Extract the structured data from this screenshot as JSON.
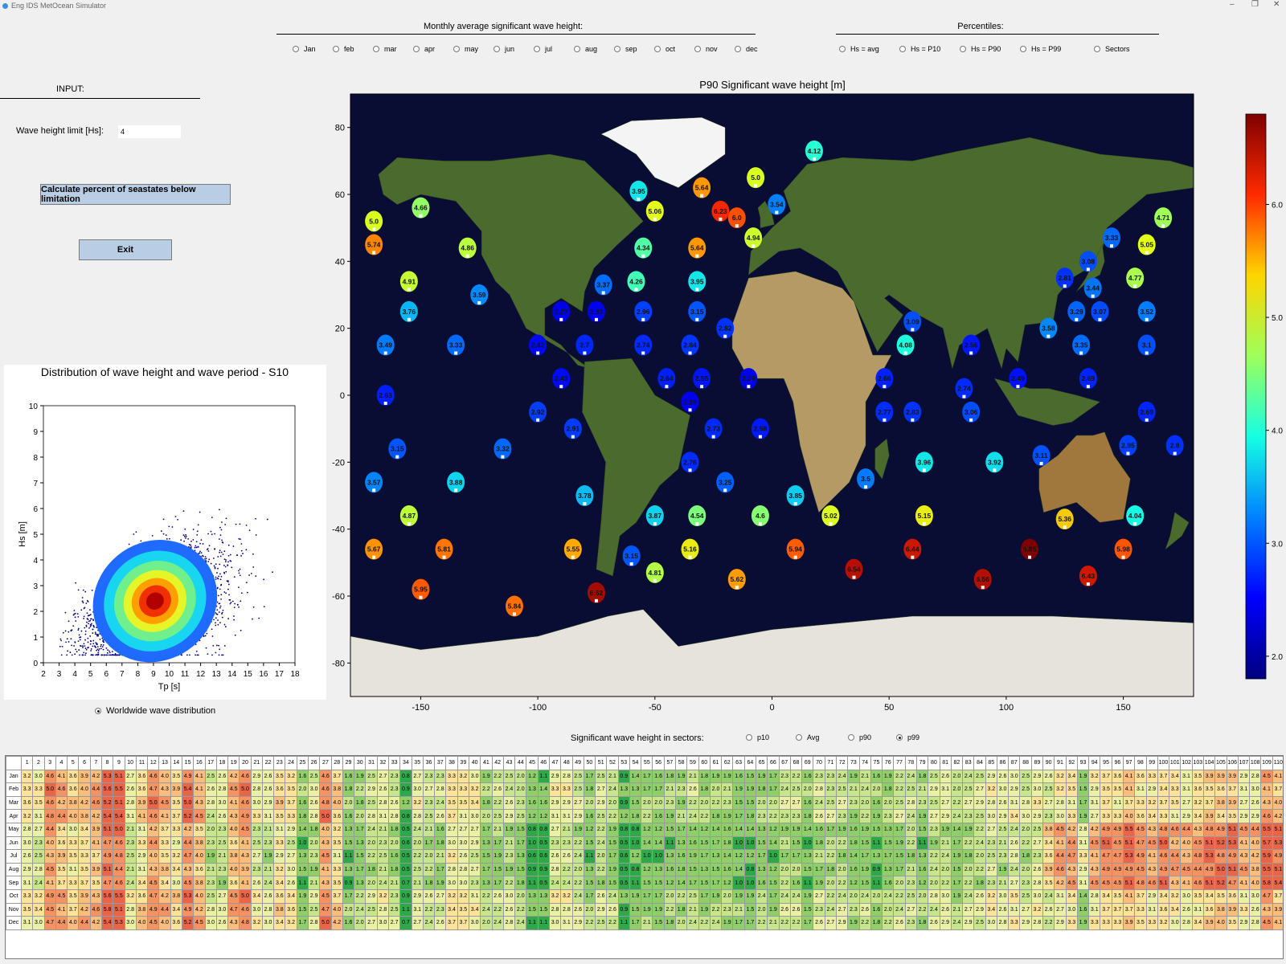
{
  "window": {
    "title": "Eng IDS MetOcean Simulator",
    "min_icon": "minimize-icon",
    "max_icon": "maximize-icon",
    "close_icon": "close-icon"
  },
  "monthly": {
    "title": "Monthly average significant wave height:",
    "options": [
      "Jan",
      "feb",
      "mar",
      "apr",
      "may",
      "jun",
      "jul",
      "aug",
      "sep",
      "oct",
      "nov",
      "dec"
    ]
  },
  "percentiles": {
    "title": "Percentiles:",
    "options": [
      "Hs = avg",
      "Hs = P10",
      "Hs = P90",
      "Hs = P99",
      "Sectors"
    ]
  },
  "input": {
    "title": "INPUT:",
    "wave_label": "Wave height limit [Hs]:",
    "wave_value": "4",
    "calc_button": "Calculate percent of seastates below limitation",
    "exit_button": "Exit"
  },
  "map": {
    "title": "P90 Significant wave height [m]",
    "xticks": [
      "-150",
      "-100",
      "-50",
      "0",
      "50",
      "100",
      "150"
    ],
    "yticks": [
      "80",
      "60",
      "40",
      "20",
      "0",
      "-20",
      "-40",
      "-60",
      "-80"
    ],
    "colorbar_ticks": [
      "6.0",
      "5.0",
      "4.0",
      "3.0",
      "2.0"
    ],
    "colorbar_colors": [
      "#7f0000",
      "#ff2a00",
      "#ffd500",
      "#9dff5a",
      "#17ffe3",
      "#0080ff",
      "#0000ff",
      "#00007f"
    ],
    "markers": [
      {
        "lon": -170,
        "lat": 52,
        "v": "5.0"
      },
      {
        "lon": -150,
        "lat": 56,
        "v": "4.66"
      },
      {
        "lon": -170,
        "lat": 45,
        "v": "5.74"
      },
      {
        "lon": -130,
        "lat": 44,
        "v": "4.86"
      },
      {
        "lon": -155,
        "lat": 34,
        "v": "4.91"
      },
      {
        "lon": -125,
        "lat": 30,
        "v": "3.59"
      },
      {
        "lon": -155,
        "lat": 25,
        "v": "3.76"
      },
      {
        "lon": -165,
        "lat": 15,
        "v": "3.49"
      },
      {
        "lon": -135,
        "lat": 15,
        "v": "3.33"
      },
      {
        "lon": -165,
        "lat": 0,
        "v": "2.63"
      },
      {
        "lon": -160,
        "lat": -16,
        "v": "3.15"
      },
      {
        "lon": -115,
        "lat": -16,
        "v": "3.32"
      },
      {
        "lon": -170,
        "lat": -26,
        "v": "3.57"
      },
      {
        "lon": -135,
        "lat": -26,
        "v": "3.88"
      },
      {
        "lon": -155,
        "lat": -36,
        "v": "4.87"
      },
      {
        "lon": -170,
        "lat": -46,
        "v": "5.67"
      },
      {
        "lon": -140,
        "lat": -46,
        "v": "5.81"
      },
      {
        "lon": -150,
        "lat": -58,
        "v": "5.95"
      },
      {
        "lon": -110,
        "lat": -63,
        "v": "5.84"
      },
      {
        "lon": -85,
        "lat": -46,
        "v": "5.55"
      },
      {
        "lon": -75,
        "lat": -59,
        "v": "6.62"
      },
      {
        "lon": -60,
        "lat": -48,
        "v": "3.15"
      },
      {
        "lon": -50,
        "lat": -53,
        "v": "4.81"
      },
      {
        "lon": -35,
        "lat": -46,
        "v": "5.16"
      },
      {
        "lon": -15,
        "lat": -55,
        "v": "5.62"
      },
      {
        "lon": -80,
        "lat": -30,
        "v": "3.78"
      },
      {
        "lon": -50,
        "lat": -36,
        "v": "3.87"
      },
      {
        "lon": -32,
        "lat": -36,
        "v": "4.54"
      },
      {
        "lon": -5,
        "lat": -36,
        "v": "4.6"
      },
      {
        "lon": 10,
        "lat": -30,
        "v": "3.85"
      },
      {
        "lon": 25,
        "lat": -36,
        "v": "5.02"
      },
      {
        "lon": 10,
        "lat": -46,
        "v": "5.94"
      },
      {
        "lon": 35,
        "lat": -52,
        "v": "6.54"
      },
      {
        "lon": 60,
        "lat": -46,
        "v": "6.44"
      },
      {
        "lon": 110,
        "lat": -46,
        "v": "6.85"
      },
      {
        "lon": 150,
        "lat": -46,
        "v": "5.98"
      },
      {
        "lon": 90,
        "lat": -55,
        "v": "6.56"
      },
      {
        "lon": 135,
        "lat": -54,
        "v": "6.43"
      },
      {
        "lon": 65,
        "lat": -36,
        "v": "5.15"
      },
      {
        "lon": 125,
        "lat": -37,
        "v": "5.36"
      },
      {
        "lon": 155,
        "lat": -36,
        "v": "4.04"
      },
      {
        "lon": 40,
        "lat": -25,
        "v": "3.5"
      },
      {
        "lon": 65,
        "lat": -20,
        "v": "3.96"
      },
      {
        "lon": 95,
        "lat": -20,
        "v": "3.92"
      },
      {
        "lon": 115,
        "lat": -18,
        "v": "3.11"
      },
      {
        "lon": 152,
        "lat": -15,
        "v": "2.95"
      },
      {
        "lon": 172,
        "lat": -15,
        "v": "2.8"
      },
      {
        "lon": -35,
        "lat": -20,
        "v": "2.76"
      },
      {
        "lon": -20,
        "lat": -26,
        "v": "3.25"
      },
      {
        "lon": -25,
        "lat": -10,
        "v": "2.73"
      },
      {
        "lon": -5,
        "lat": -10,
        "v": "2.58"
      },
      {
        "lon": -100,
        "lat": -5,
        "v": "2.92"
      },
      {
        "lon": -85,
        "lat": -10,
        "v": "2.91"
      },
      {
        "lon": -35,
        "lat": -2,
        "v": "2.29"
      },
      {
        "lon": -45,
        "lat": 5,
        "v": "2.64"
      },
      {
        "lon": -30,
        "lat": 5,
        "v": "2.55"
      },
      {
        "lon": -10,
        "lat": 5,
        "v": "2.29"
      },
      {
        "lon": -90,
        "lat": 5,
        "v": "2.43"
      },
      {
        "lon": -100,
        "lat": 15,
        "v": "2.42"
      },
      {
        "lon": -80,
        "lat": 15,
        "v": "2.7"
      },
      {
        "lon": -55,
        "lat": 15,
        "v": "2.74"
      },
      {
        "lon": -35,
        "lat": 15,
        "v": "2.84"
      },
      {
        "lon": -20,
        "lat": 20,
        "v": "2.82"
      },
      {
        "lon": -90,
        "lat": 25,
        "v": "2.27"
      },
      {
        "lon": -75,
        "lat": 25,
        "v": "2.33"
      },
      {
        "lon": -55,
        "lat": 25,
        "v": "2.96"
      },
      {
        "lon": -32,
        "lat": 25,
        "v": "3.15"
      },
      {
        "lon": -72,
        "lat": 33,
        "v": "3.37"
      },
      {
        "lon": -58,
        "lat": 34,
        "v": "4.26"
      },
      {
        "lon": -32,
        "lat": 34,
        "v": "3.95"
      },
      {
        "lon": -55,
        "lat": 44,
        "v": "4.34"
      },
      {
        "lon": -32,
        "lat": 44,
        "v": "5.64"
      },
      {
        "lon": -57,
        "lat": 61,
        "v": "3.95"
      },
      {
        "lon": -50,
        "lat": 55,
        "v": "5.06"
      },
      {
        "lon": -30,
        "lat": 62,
        "v": "5.64"
      },
      {
        "lon": -22,
        "lat": 55,
        "v": "6.23"
      },
      {
        "lon": -15,
        "lat": 53,
        "v": "6.0"
      },
      {
        "lon": -7,
        "lat": 65,
        "v": "5.0"
      },
      {
        "lon": -8,
        "lat": 47,
        "v": "4.94"
      },
      {
        "lon": 2,
        "lat": 57,
        "v": "3.54"
      },
      {
        "lon": 18,
        "lat": 73,
        "v": "4.12"
      },
      {
        "lon": 60,
        "lat": 22,
        "v": "3.09"
      },
      {
        "lon": 57,
        "lat": 15,
        "v": "4.08"
      },
      {
        "lon": 85,
        "lat": 15,
        "v": "2.56"
      },
      {
        "lon": 48,
        "lat": 5,
        "v": "2.66"
      },
      {
        "lon": 82,
        "lat": 2,
        "v": "2.74"
      },
      {
        "lon": 48,
        "lat": -5,
        "v": "2.77"
      },
      {
        "lon": 60,
        "lat": -5,
        "v": "2.83"
      },
      {
        "lon": 85,
        "lat": -5,
        "v": "3.06"
      },
      {
        "lon": 105,
        "lat": 5,
        "v": "2.49"
      },
      {
        "lon": 135,
        "lat": 5,
        "v": "2.69"
      },
      {
        "lon": 160,
        "lat": -5,
        "v": "2.69"
      },
      {
        "lon": 118,
        "lat": 20,
        "v": "3.58"
      },
      {
        "lon": 130,
        "lat": 25,
        "v": "3.29"
      },
      {
        "lon": 140,
        "lat": 25,
        "v": "3.07"
      },
      {
        "lon": 132,
        "lat": 15,
        "v": "3.35"
      },
      {
        "lon": 160,
        "lat": 15,
        "v": "3.1"
      },
      {
        "lon": 160,
        "lat": 25,
        "v": "3.52"
      },
      {
        "lon": 125,
        "lat": 35,
        "v": "2.81"
      },
      {
        "lon": 137,
        "lat": 32,
        "v": "3.44"
      },
      {
        "lon": 135,
        "lat": 40,
        "v": "3.08"
      },
      {
        "lon": 145,
        "lat": 47,
        "v": "3.33"
      },
      {
        "lon": 155,
        "lat": 35,
        "v": "4.77"
      },
      {
        "lon": 160,
        "lat": 45,
        "v": "5.05"
      },
      {
        "lon": 167,
        "lat": 53,
        "v": "4.71"
      }
    ]
  },
  "scatter": {
    "title": "Distribution of wave height and wave period - S10",
    "xlabel": "Tp [s]",
    "ylabel": "Hs [m]",
    "xticks": [
      "2",
      "3",
      "4",
      "5",
      "6",
      "7",
      "8",
      "9",
      "10",
      "11",
      "12",
      "13",
      "14",
      "15",
      "16",
      "17",
      "18"
    ],
    "yticks": [
      "0",
      "1",
      "2",
      "3",
      "4",
      "5",
      "6",
      "7",
      "8",
      "9",
      "10"
    ]
  },
  "worldwide_radio": "Worldwide wave distribution",
  "sectors": {
    "title": "Significant wave height in sectors:",
    "options": [
      "p10",
      "Avg",
      "p90",
      "p99"
    ],
    "selected": "p99"
  },
  "table": {
    "months": [
      "Jan",
      "Feb",
      "Mar",
      "Apr",
      "May",
      "Jun",
      "Jul",
      "Aug",
      "Sep",
      "Oct",
      "Nov",
      "Dec"
    ],
    "row_jan": [
      "3.2",
      "3.0",
      "4.6",
      "4.1",
      "3.6",
      "3.9",
      "4.2",
      "5.3",
      "5.1",
      "2.7",
      "3.6",
      "4.6",
      "4.0",
      "3.5",
      "4.9",
      "4.1",
      "2.5",
      "2.6",
      "4.2",
      "4.6",
      "2.9",
      "2.6",
      "3.5",
      "3.2",
      "1.6",
      "2.5",
      "4.6",
      "3.7",
      "1.6",
      "1.9",
      "2.5",
      "2.7",
      "2.3",
      "0.8",
      "2.7",
      "2.3",
      "2.3",
      "3.3",
      "3.2",
      "3.0",
      "1.9",
      "2.2",
      "2.5",
      "2.0",
      "1.2",
      "1.1",
      "2.9",
      "2.8",
      "2.5",
      "1.7",
      "2.5",
      "2.1",
      "0.9",
      "1.4",
      "1.7",
      "1.6",
      "1.8",
      "1.9",
      "2.1",
      "1.8",
      "1.9",
      "1.9",
      "1.6",
      "1.5",
      "1.9",
      "1.7",
      "2.3",
      "2.2",
      "1.6",
      "2.3",
      "2.3",
      "2.4",
      "1.9",
      "2.1",
      "1.6",
      "1.9",
      "2.2",
      "2.4",
      "1.8",
      "2.5",
      "2.6",
      "2.0",
      "2.4",
      "2.5",
      "2.9",
      "2.6",
      "3.0",
      "2.5",
      "2.9",
      "2.6",
      "3.2",
      "3.4",
      "1.9",
      "3.2",
      "3.7",
      "3.6",
      "4.1",
      "3.6",
      "3.3",
      "3.7",
      "3.4",
      "3.1",
      "3.5",
      "3.9",
      "3.9",
      "3.9"
    ]
  }
}
